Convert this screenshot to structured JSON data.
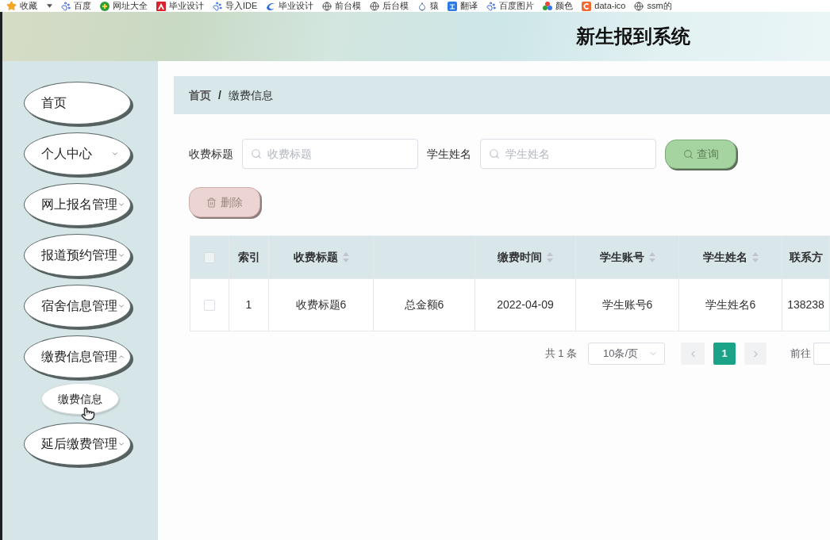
{
  "bookmarks_bar": {
    "items": [
      {
        "label": "收藏",
        "menu": true
      },
      {
        "label": "百度"
      },
      {
        "label": "网址大全"
      },
      {
        "label": "毕业设计"
      },
      {
        "label": "导入IDE"
      },
      {
        "label": "毕业设计"
      },
      {
        "label": "前台模"
      },
      {
        "label": "后台模"
      },
      {
        "label": "猿"
      },
      {
        "label": "翻译"
      },
      {
        "label": "百度图片"
      },
      {
        "label": "颜色"
      },
      {
        "label": "data-ico"
      },
      {
        "label": "ssm的"
      }
    ]
  },
  "header": {
    "title": "新生报到系统"
  },
  "sidebar": {
    "items": [
      {
        "label": "首页"
      },
      {
        "label": "个人中心",
        "expanded": false
      },
      {
        "label": "网上报名管理",
        "expanded": false
      },
      {
        "label": "报道预约管理",
        "expanded": false
      },
      {
        "label": "宿舍信息管理",
        "expanded": false
      },
      {
        "label": "缴费信息管理",
        "expanded": true,
        "children": [
          {
            "label": "缴费信息"
          }
        ]
      },
      {
        "label": "延后缴费管理",
        "expanded": false
      }
    ]
  },
  "breadcrumb": {
    "items": [
      "首页",
      "缴费信息"
    ],
    "separator": "/"
  },
  "search": {
    "fields": [
      {
        "label": "收费标题",
        "placeholder": "收费标题"
      },
      {
        "label": "学生姓名",
        "placeholder": "学生姓名"
      }
    ],
    "button": "查询"
  },
  "actions": {
    "delete_button": "删除"
  },
  "table": {
    "select_all": {
      "checked": false
    },
    "columns": [
      {
        "label": "索引",
        "sortable": false
      },
      {
        "label": "收费标题",
        "sortable": true
      },
      {
        "sortable": false
      },
      {
        "label": "缴费时间",
        "sortable": true
      },
      {
        "label": "学生账号",
        "sortable": true
      },
      {
        "label": "学生姓名",
        "sortable": true
      },
      {
        "label": "联系方",
        "sortable": false
      }
    ],
    "rows": [
      {
        "checked": false,
        "cells": [
          "1",
          "收费标题6",
          "总金额6",
          "2022-04-09",
          "学生账号6",
          "学生姓名6",
          "138238"
        ]
      }
    ]
  },
  "pagination": {
    "total": "共 1 条",
    "page_size": "10条/页",
    "pages": [
      {
        "label": "1",
        "selected": true
      }
    ],
    "goto_label": "前往"
  }
}
